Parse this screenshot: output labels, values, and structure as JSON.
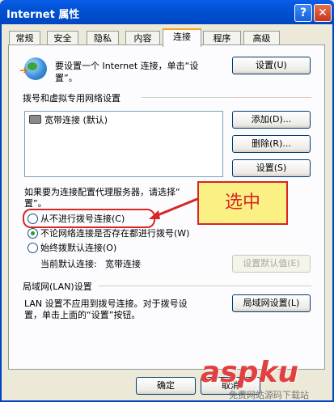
{
  "window": {
    "title": "Internet 属性",
    "help_label": "?",
    "close_label": "✕"
  },
  "tabs": [
    {
      "label": "常规"
    },
    {
      "label": "安全"
    },
    {
      "label": "隐私"
    },
    {
      "label": "内容"
    },
    {
      "label": "连接",
      "active": true
    },
    {
      "label": "程序"
    },
    {
      "label": "高级"
    }
  ],
  "setup": {
    "text_line1": "要设置一个 Internet 连接，单击“设",
    "text_line2": "置”。",
    "button": "设置(U)",
    "icon": "globe-icon"
  },
  "dialup": {
    "group_label": "拨号和虚拟专用网络设置",
    "list": [
      {
        "label": "宽带连接 (默认)",
        "icon": "modem-icon"
      }
    ],
    "add_button": "添加(D)...",
    "remove_button": "删除(R)...",
    "settings_button": "设置(S)"
  },
  "proxy_note": {
    "line1": "如果要为连接配置代理服务器，请选择“",
    "line2": "置”。"
  },
  "radios": [
    {
      "label": "从不进行拨号连接(C)",
      "selected": false
    },
    {
      "label": "不论网络连接是否存在都进行拨号(W)",
      "selected": true
    },
    {
      "label": "始终拨默认连接(O)",
      "selected": false
    }
  ],
  "current_default": {
    "label": "当前默认连接:",
    "value": "宽带连接",
    "button": "设置默认值(E)"
  },
  "lan": {
    "group_label": "局域网(LAN)设置",
    "text_line1": "LAN 设置不应用到拨号连接。对于拨号设",
    "text_line2": "置，单击上面的“设置”按钮。",
    "button": "局域网设置(L)"
  },
  "footer": {
    "ok": "确定",
    "cancel": "取消"
  },
  "annotation": {
    "callout": "选中",
    "accent": "#D92525"
  },
  "watermark": {
    "main": "aspku",
    "sub": "免费网站源码下载站"
  }
}
